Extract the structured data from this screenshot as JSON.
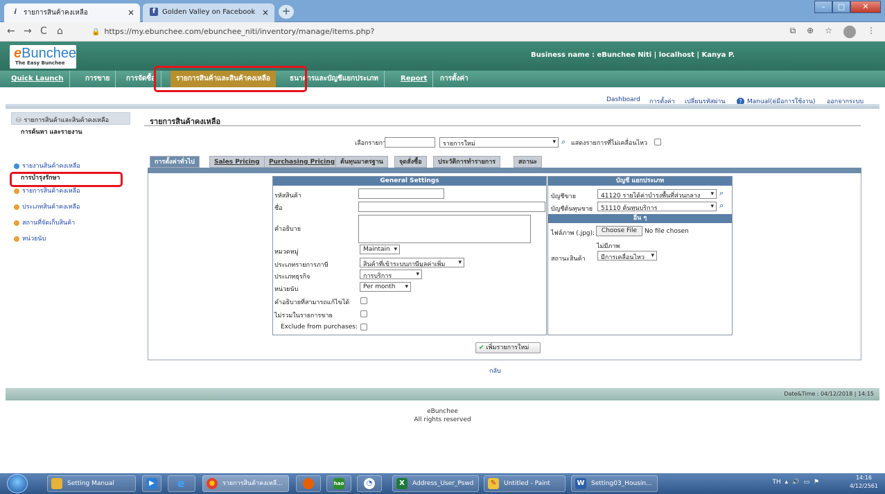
{
  "browser": {
    "tabs": [
      {
        "label": "รายการสินค้าคงเหลือ",
        "icon": "info-icon"
      },
      {
        "label": "Golden Valley on Facebook",
        "icon": "facebook-icon"
      }
    ],
    "url": "https://my.ebunchee.com/ebunchee_niti/inventory/manage/items.php?"
  },
  "app": {
    "logo_main": "Bunchee",
    "logo_e": "e",
    "logo_sub": "The Easy Bunchee",
    "business_name": "Business name : eBunchee Niti | localhost | Kanya P."
  },
  "menu": [
    "Quick Launch",
    "การขาย",
    "การจัดซื้อ",
    "รายการสินค้าและสินค้าคงเหลือ",
    "ธนาคารและบัญชีแยกประเภท",
    "Report",
    "การตั้งค่า"
  ],
  "top_links": {
    "dashboard": "Dashboard",
    "settings": "การตั้งค่า",
    "change_password": "เปลี่ยนรหัสผ่าน",
    "manual": "Manual(คู่มือการใช้งาน)",
    "logout": "ออกจากระบบ"
  },
  "sidebar": {
    "head": "รายการสินค้าและสินค้าคงเหลือ",
    "sub1": "การค้นหา และรายงาน",
    "report_item": "รายงานสินค้าคงเหลือ",
    "sub2": "การบำรุงรักษา",
    "items": [
      "รายการสินค้าคงเหลือ",
      "ประเภทสินค้าคงเหลือ",
      "สถานที่จัดเก็บสินค้า",
      "หน่วยนับ"
    ]
  },
  "page": {
    "title": "รายการสินค้าคงเหลือ",
    "select_label": "เลือกรายการ",
    "select_value": "รายการใหม่",
    "show_inactive": "แสดงรายการที่ไม่เคลื่อนไหว",
    "tabs": [
      "การตั้งค่าทั่วไป",
      "Sales Pricing",
      "Purchasing Pricing",
      "ต้นทุนมาตรฐาน",
      "จุดสั่งซื้อ",
      "ประวัติการทำรายการ",
      "สถานะ"
    ],
    "general_settings": {
      "title": "General Settings",
      "code": "รหัสสินค้า",
      "name": "ชื่อ",
      "description": "คำอธิบาย",
      "category": "หมวดหมู่",
      "category_value": "Maintain",
      "tax_type": "ประเภทรายการภาษี",
      "tax_type_value": "สินค้าที่เข้าระบบภาษีมูลค่าเพิ่ม",
      "business_type": "ประเภทธุรกิจ",
      "business_type_value": "การบริการ",
      "unit": "หน่วยนับ",
      "unit_value": "Per month",
      "editable_desc": "คำอธิบายที่สามารถแก้ไขได้",
      "exclude_sales": "ไม่รวมในรายการขาย",
      "exclude_purchases": "Exclude from purchases:"
    },
    "accounts": {
      "title": "บัญชี แยกประเภท",
      "sales_account": "บัญชีขาย",
      "sales_account_value": "41120  รายได้ค่าบำรุงพื้นที่ส่วนกลาง",
      "cost_account": "บัญชีต้นทุนขาย",
      "cost_account_value": "51110  ต้นทุนบริการ"
    },
    "others": {
      "title": "อื่น ๆ",
      "image": "ไฟล์ภาพ (.jpg):",
      "choose_file": "Choose File",
      "no_file": "No file chosen",
      "no_image": "ไม่มีภาพ",
      "status": "สถานะสินค้า",
      "status_value": "มีการเคลื่อนไหว"
    },
    "add_button": "เพิ่มรายการใหม่",
    "back": "กลับ"
  },
  "footer": {
    "datetime": "Date&Time : 04/12/2018 | 14:15",
    "line1": "eBunchee",
    "line2": "All rights reserved"
  },
  "taskbar": {
    "items": [
      {
        "label": "Setting Manual"
      },
      {
        "label": "รายการสินค้าคงเหลื..."
      },
      {
        "label": "Address_User_Pswd"
      },
      {
        "label": "Untitled - Paint"
      },
      {
        "label": "Setting03_Housin..."
      }
    ],
    "lang": "TH",
    "time": "14:16",
    "date": "4/12/2561"
  }
}
